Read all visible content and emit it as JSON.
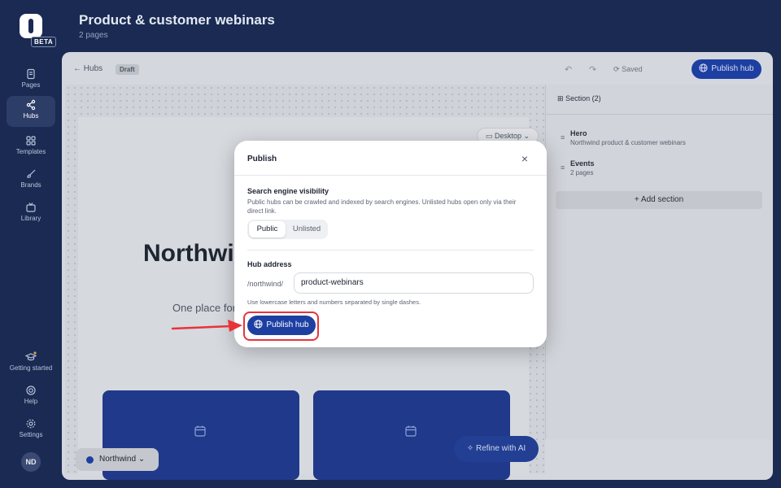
{
  "rail": {
    "logo_badge": "BETA",
    "items": [
      {
        "label": "Pages",
        "icon": "pages-icon"
      },
      {
        "label": "Hubs",
        "icon": "share-icon",
        "active": true
      },
      {
        "label": "Templates",
        "icon": "grid-icon"
      },
      {
        "label": "Brands",
        "icon": "brush-icon"
      },
      {
        "label": "Library",
        "icon": "tv-icon"
      }
    ],
    "bottom_items": [
      {
        "label": "Getting started",
        "icon": "graduation-cap-icon"
      },
      {
        "label": "Help",
        "icon": "lifebuoy-icon"
      },
      {
        "label": "Settings",
        "icon": "gear-icon"
      }
    ],
    "avatar": "ND"
  },
  "header": {
    "title": "Product & customer webinars",
    "subtitle": "2 pages"
  },
  "toolbar": {
    "back_label": "Hubs",
    "status_badge": "Draft",
    "saved_label": "Saved",
    "publish_label": "Publish hub",
    "accent": "#1d3fa2"
  },
  "canvas": {
    "device_label": "Desktop",
    "hero_title": "Northwind",
    "hero_subtitle": "One place for",
    "refine_label": "Refine with AI",
    "brand_selector": "Northwind"
  },
  "sections_panel": {
    "header": "Section (2)",
    "sections": [
      {
        "name": "Hero",
        "detail": "Northwind product & customer webinars"
      },
      {
        "name": "Events",
        "detail": "2 pages"
      }
    ],
    "add_label": "Add section"
  },
  "modal": {
    "title": "Publish",
    "visibility": {
      "heading": "Search engine visibility",
      "description": "Public hubs can be crawled and indexed by search engines. Unlisted hubs open only via their direct link.",
      "options": [
        "Public",
        "Unlisted"
      ],
      "selected": "Public"
    },
    "address": {
      "heading": "Hub address",
      "prefix": "/northwind/",
      "value": "product-webinars",
      "hint": "Use lowercase letters and numbers separated by single dashes."
    },
    "publish_label": "Publish hub",
    "highlight_color": "#e8333a"
  }
}
